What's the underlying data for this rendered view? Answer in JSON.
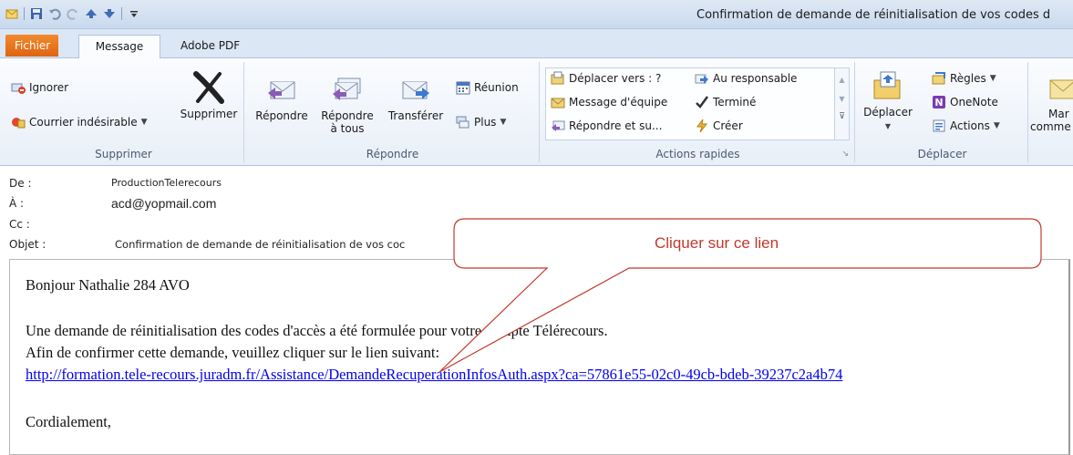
{
  "window": {
    "title": "Confirmation de demande de réinitialisation de vos codes d"
  },
  "tabs": {
    "fichier": "Fichier",
    "message": "Message",
    "adobe": "Adobe PDF"
  },
  "ribbon": {
    "supprimer_group": {
      "ignorer": "Ignorer",
      "courrier": "Courrier indésirable",
      "supprimer": "Supprimer",
      "label": "Supprimer"
    },
    "repondre_group": {
      "repondre": "Répondre",
      "repondre_tous_1": "Répondre",
      "repondre_tous_2": "à tous",
      "transferer": "Transférer",
      "reunion": "Réunion",
      "plus": "Plus",
      "label": "Répondre"
    },
    "actions_group": {
      "deplacer_vers": "Déplacer vers : ?",
      "message_equipe": "Message d'équipe",
      "repondre_su": "Répondre et su...",
      "au_responsable": "Au responsable",
      "termine": "Terminé",
      "creer": "Créer",
      "label": "Actions rapides"
    },
    "deplacer_group": {
      "deplacer": "Déplacer",
      "regles": "Règles",
      "onenote": "OneNote",
      "actions": "Actions",
      "label": "Déplacer"
    },
    "marquer": {
      "line1": "Mar",
      "line2": "comme"
    }
  },
  "header": {
    "de_label": "De :",
    "de_value": "ProductionTelerecours",
    "a_label": "À :",
    "a_value": "acd@yopmail.com",
    "cc_label": "Cc :",
    "objet_label": "Objet :",
    "objet_value": "Confirmation de demande de réinitialisation de vos coc"
  },
  "body": {
    "greeting": "Bonjour Nathalie 284 AVO",
    "line1": "Une demande de réinitialisation des codes d'accès a été formulée pour votre compte Télérecours.",
    "line2": "Afin de confirmer cette demande, veuillez cliquer sur le lien suivant:",
    "link": "http://formation.tele-recours.juradm.fr/Assistance/DemandeRecuperationInfosAuth.aspx?ca=57861e55-02c0-49cb-bdeb-39237c2a4b74",
    "closing": "Cordialement,"
  },
  "callout": {
    "text": "Cliquer sur ce lien"
  },
  "colors": {
    "accent_orange": "#e4731e",
    "callout_red": "#c0392b",
    "link_blue": "#0000ee"
  }
}
